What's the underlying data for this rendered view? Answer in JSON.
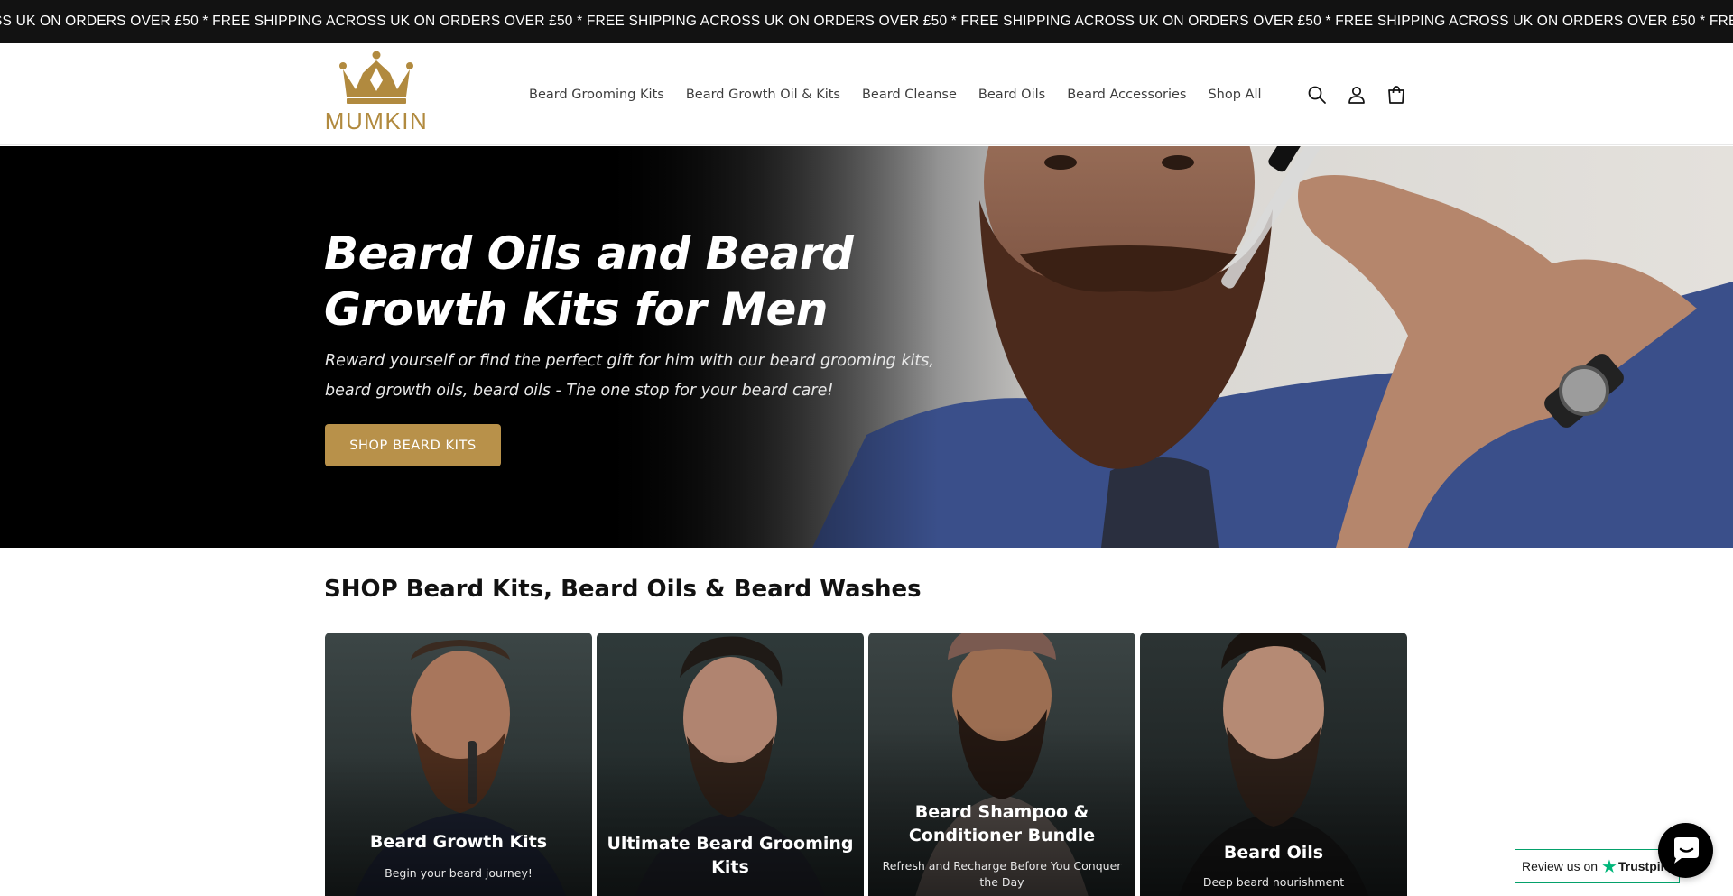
{
  "announcement": {
    "text": "SS UK ON ORDERS OVER £50 * FREE SHIPPING ACROSS UK ON ORDERS OVER £50 * FREE SHIPPING ACROSS UK ON ORDERS OVER £50 * FREE SHIPPING ACROSS UK ON ORDERS OVER £50 * FREE SHIPPING ACROSS UK ON ORDERS OVER £50 * FREE SHIPPING"
  },
  "header": {
    "logo_text": "MUMKIN",
    "logo_icon": "crown-icon",
    "nav": [
      {
        "label": "Beard Grooming Kits"
      },
      {
        "label": "Beard Growth Oil & Kits"
      },
      {
        "label": "Beard Cleanse"
      },
      {
        "label": "Beard Oils"
      },
      {
        "label": "Beard Accessories"
      },
      {
        "label": "Shop All"
      }
    ],
    "icons": [
      "search-icon",
      "account-icon",
      "cart-icon"
    ]
  },
  "hero": {
    "title": "Beard Oils and Beard Growth Kits for Men",
    "subtitle": "Reward yourself or find the perfect gift for him with our beard grooming kits, beard growth oils, beard oils - The one stop for your beard care!",
    "button_label": "SHOP BEARD KITS"
  },
  "collections": {
    "heading": "SHOP Beard Kits, Beard Oils & Beard Washes",
    "cards": [
      {
        "title": "Beard Growth Kits",
        "subtitle": "Begin your beard journey!"
      },
      {
        "title": "Ultimate Beard Grooming Kits",
        "subtitle": ""
      },
      {
        "title": "Beard Shampoo & Conditioner Bundle",
        "subtitle": "Refresh and Recharge Before You Conquer the Day"
      },
      {
        "title": "Beard Oils",
        "subtitle": "Deep beard nourishment"
      }
    ]
  },
  "trustpilot": {
    "label": "Review us on",
    "brand": "Trustpilot"
  },
  "chat": {
    "icon": "chat-bubble-icon"
  },
  "colors": {
    "accent": "#b8914a",
    "logo_gold": "#b18a3f",
    "announcement_bg": "#121212",
    "trustpilot_green": "#00b67a"
  }
}
